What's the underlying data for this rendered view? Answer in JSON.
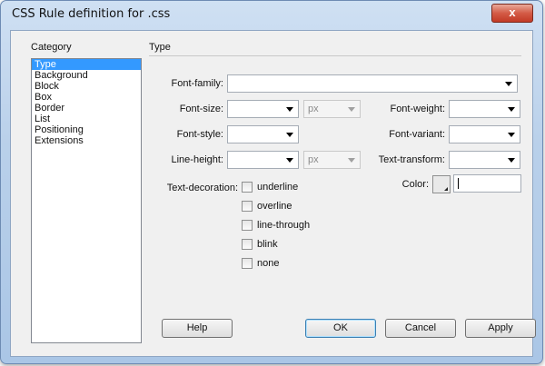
{
  "window": {
    "title": "CSS Rule definition for .css",
    "close_label": "x"
  },
  "category": {
    "heading": "Category",
    "items": [
      "Type",
      "Background",
      "Block",
      "Box",
      "Border",
      "List",
      "Positioning",
      "Extensions"
    ],
    "selected_index": 0
  },
  "panel": {
    "heading": "Type",
    "font_family": {
      "label": "Font-family:",
      "value": ""
    },
    "font_size": {
      "label": "Font-size:",
      "value": "",
      "unit": "px"
    },
    "font_weight": {
      "label": "Font-weight:",
      "value": ""
    },
    "font_style": {
      "label": "Font-style:",
      "value": ""
    },
    "font_variant": {
      "label": "Font-variant:",
      "value": ""
    },
    "line_height": {
      "label": "Line-height:",
      "value": "",
      "unit": "px"
    },
    "text_transform": {
      "label": "Text-transform:",
      "value": ""
    },
    "text_decoration": {
      "label": "Text-decoration:",
      "options": [
        "underline",
        "overline",
        "line-through",
        "blink",
        "none"
      ]
    },
    "color": {
      "label": "Color:",
      "value": ""
    }
  },
  "buttons": {
    "help": "Help",
    "ok": "OK",
    "cancel": "Cancel",
    "apply": "Apply"
  }
}
